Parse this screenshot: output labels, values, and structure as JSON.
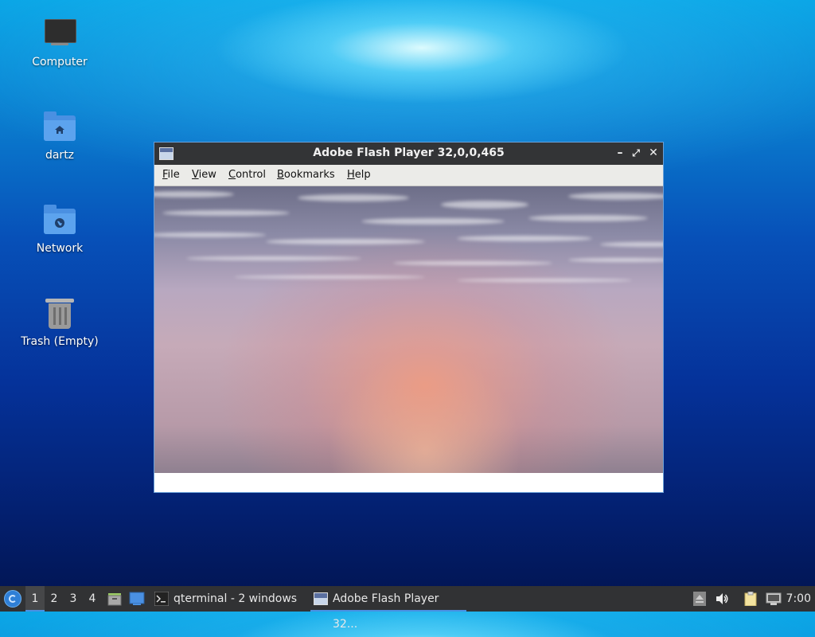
{
  "desktop": {
    "icons": [
      {
        "label": "Computer",
        "icon": "computer-icon"
      },
      {
        "label": "dartz",
        "icon": "home-folder-icon"
      },
      {
        "label": "Network",
        "icon": "network-folder-icon"
      },
      {
        "label": "Trash (Empty)",
        "icon": "trash-icon"
      }
    ]
  },
  "window": {
    "title": "Adobe Flash Player 32,0,0,465",
    "controls": {
      "minimize": "–",
      "maximize": "⤢",
      "close": "✕"
    },
    "menu": [
      {
        "underline": "F",
        "rest": "ile"
      },
      {
        "underline": "V",
        "rest": "iew"
      },
      {
        "underline": "C",
        "rest": "ontrol"
      },
      {
        "underline": "B",
        "rest": "ookmarks"
      },
      {
        "underline": "H",
        "rest": "elp"
      }
    ]
  },
  "taskbar": {
    "workspaces": [
      "1",
      "2",
      "3",
      "4"
    ],
    "active_workspace": "1",
    "tasks": [
      {
        "label": "qterminal - 2 windows",
        "icon": "terminal-icon"
      },
      {
        "label": "Adobe Flash Player 32...",
        "icon": "flash-window-icon",
        "active": true
      }
    ],
    "clock": "7:00",
    "accent": "#4a90e2"
  }
}
